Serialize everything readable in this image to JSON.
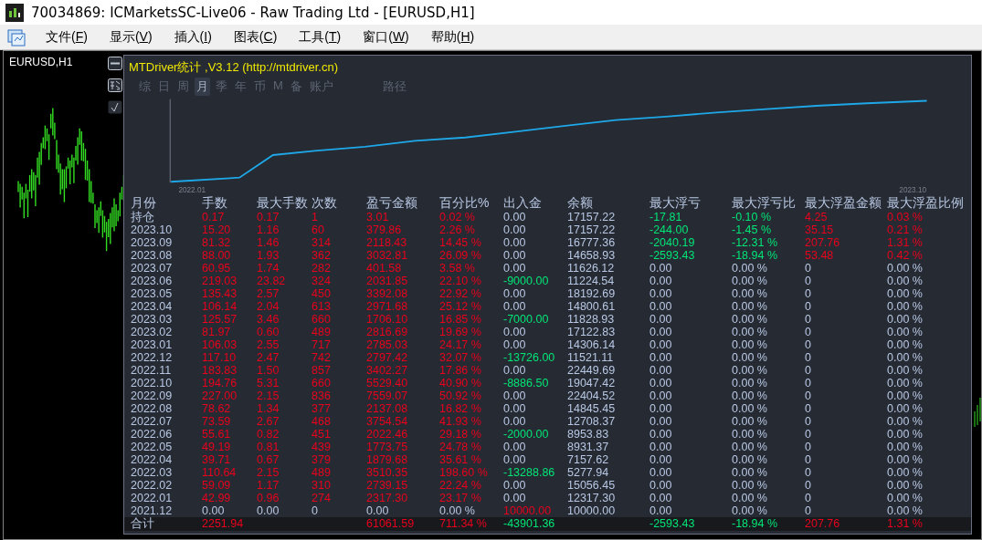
{
  "window": {
    "title": "70034869: ICMarketsSC-Live06 - Raw Trading Ltd - [EURUSD,H1]"
  },
  "menu": [
    {
      "label": "文件(F)"
    },
    {
      "label": "显示(V)"
    },
    {
      "label": "插入(I)"
    },
    {
      "label": "图表(C)"
    },
    {
      "label": "工具(T)"
    },
    {
      "label": "窗口(W)"
    },
    {
      "label": "帮助(H)"
    }
  ],
  "chart": {
    "symbol": "EURUSD,H1"
  },
  "panel": {
    "title": "MTDriver统计 ,V3.12 (http://mtdriver.cn)",
    "tabs": [
      {
        "label": "综",
        "selected": false
      },
      {
        "label": "日",
        "selected": false
      },
      {
        "label": "周",
        "selected": false
      },
      {
        "label": "月",
        "selected": true
      },
      {
        "label": "季",
        "selected": false
      },
      {
        "label": "年",
        "selected": false
      },
      {
        "label": "币",
        "selected": false
      },
      {
        "label": "M",
        "selected": false
      },
      {
        "label": "备",
        "selected": false
      },
      {
        "label": "账户",
        "selected": false
      },
      {
        "label": "路径",
        "selected": false
      }
    ],
    "equity_axis": {
      "start": "2022.01",
      "end": "2023.10"
    },
    "columns": [
      "月份",
      "手数",
      "最大手数",
      "次数",
      "盈亏金额",
      "百分比%",
      "出入金",
      "余额",
      "最大浮亏",
      "最大浮亏比",
      "最大浮盈金额",
      "最大浮盈比例"
    ],
    "rows": [
      {
        "cells": [
          {
            "text": "持仓",
            "color": "#b8c8e4"
          },
          {
            "text": "0.17",
            "color": "#e8001c"
          },
          {
            "text": "0.17",
            "color": "#e8001c"
          },
          {
            "text": "1",
            "color": "#e8001c"
          },
          {
            "text": "3.01",
            "color": "#e8001c"
          },
          {
            "text": "0.02 %",
            "color": "#e8001c"
          },
          {
            "text": "0.00",
            "color": "#b8c8e4"
          },
          {
            "text": "17157.22",
            "color": "#b8c8e4"
          },
          {
            "text": "-17.81",
            "color": "#00e676"
          },
          {
            "text": "-0.10 %",
            "color": "#00e676"
          },
          {
            "text": "4.25",
            "color": "#e8001c"
          },
          {
            "text": "0.03 %",
            "color": "#e8001c"
          }
        ]
      },
      {
        "cells": [
          {
            "text": "2023.10",
            "color": "#b8c8e4"
          },
          {
            "text": "15.20",
            "color": "#e8001c"
          },
          {
            "text": "1.16",
            "color": "#e8001c"
          },
          {
            "text": "60",
            "color": "#e8001c"
          },
          {
            "text": "379.86",
            "color": "#e8001c"
          },
          {
            "text": "2.26 %",
            "color": "#e8001c"
          },
          {
            "text": "0.00",
            "color": "#b8c8e4"
          },
          {
            "text": "17157.22",
            "color": "#b8c8e4"
          },
          {
            "text": "-244.00",
            "color": "#00e676"
          },
          {
            "text": "-1.45 %",
            "color": "#00e676"
          },
          {
            "text": "35.15",
            "color": "#e8001c"
          },
          {
            "text": "0.21 %",
            "color": "#e8001c"
          }
        ]
      },
      {
        "cells": [
          {
            "text": "2023.09",
            "color": "#b8c8e4"
          },
          {
            "text": "81.32",
            "color": "#e8001c"
          },
          {
            "text": "1.46",
            "color": "#e8001c"
          },
          {
            "text": "314",
            "color": "#e8001c"
          },
          {
            "text": "2118.43",
            "color": "#e8001c"
          },
          {
            "text": "14.45 %",
            "color": "#e8001c"
          },
          {
            "text": "0.00",
            "color": "#b8c8e4"
          },
          {
            "text": "16777.36",
            "color": "#b8c8e4"
          },
          {
            "text": "-2040.19",
            "color": "#00e676"
          },
          {
            "text": "-12.31 %",
            "color": "#00e676"
          },
          {
            "text": "207.76",
            "color": "#e8001c"
          },
          {
            "text": "1.31 %",
            "color": "#e8001c"
          }
        ]
      },
      {
        "cells": [
          {
            "text": "2023.08",
            "color": "#b8c8e4"
          },
          {
            "text": "88.00",
            "color": "#e8001c"
          },
          {
            "text": "1.93",
            "color": "#e8001c"
          },
          {
            "text": "362",
            "color": "#e8001c"
          },
          {
            "text": "3032.81",
            "color": "#e8001c"
          },
          {
            "text": "26.09 %",
            "color": "#e8001c"
          },
          {
            "text": "0.00",
            "color": "#b8c8e4"
          },
          {
            "text": "14658.93",
            "color": "#b8c8e4"
          },
          {
            "text": "-2593.43",
            "color": "#00e676"
          },
          {
            "text": "-18.94 %",
            "color": "#00e676"
          },
          {
            "text": "53.48",
            "color": "#e8001c"
          },
          {
            "text": "0.42 %",
            "color": "#e8001c"
          }
        ]
      },
      {
        "cells": [
          {
            "text": "2023.07",
            "color": "#b8c8e4"
          },
          {
            "text": "60.95",
            "color": "#e8001c"
          },
          {
            "text": "1.74",
            "color": "#e8001c"
          },
          {
            "text": "282",
            "color": "#e8001c"
          },
          {
            "text": "401.58",
            "color": "#e8001c"
          },
          {
            "text": "3.58 %",
            "color": "#e8001c"
          },
          {
            "text": "0.00",
            "color": "#b8c8e4"
          },
          {
            "text": "11626.12",
            "color": "#b8c8e4"
          },
          {
            "text": "0.00",
            "color": "#b8c8e4"
          },
          {
            "text": "0.00 %",
            "color": "#b8c8e4"
          },
          {
            "text": "0",
            "color": "#b8c8e4"
          },
          {
            "text": "0.00 %",
            "color": "#b8c8e4"
          }
        ]
      },
      {
        "cells": [
          {
            "text": "2023.06",
            "color": "#b8c8e4"
          },
          {
            "text": "219.03",
            "color": "#e8001c"
          },
          {
            "text": "23.82",
            "color": "#e8001c"
          },
          {
            "text": "324",
            "color": "#e8001c"
          },
          {
            "text": "2031.85",
            "color": "#e8001c"
          },
          {
            "text": "22.10 %",
            "color": "#e8001c"
          },
          {
            "text": "-9000.00",
            "color": "#00e676"
          },
          {
            "text": "11224.54",
            "color": "#b8c8e4"
          },
          {
            "text": "0.00",
            "color": "#b8c8e4"
          },
          {
            "text": "0.00 %",
            "color": "#b8c8e4"
          },
          {
            "text": "0",
            "color": "#b8c8e4"
          },
          {
            "text": "0.00 %",
            "color": "#b8c8e4"
          }
        ]
      },
      {
        "cells": [
          {
            "text": "2023.05",
            "color": "#b8c8e4"
          },
          {
            "text": "135.43",
            "color": "#e8001c"
          },
          {
            "text": "2.57",
            "color": "#e8001c"
          },
          {
            "text": "450",
            "color": "#e8001c"
          },
          {
            "text": "3392.08",
            "color": "#e8001c"
          },
          {
            "text": "22.92 %",
            "color": "#e8001c"
          },
          {
            "text": "0.00",
            "color": "#b8c8e4"
          },
          {
            "text": "18192.69",
            "color": "#b8c8e4"
          },
          {
            "text": "0.00",
            "color": "#b8c8e4"
          },
          {
            "text": "0.00 %",
            "color": "#b8c8e4"
          },
          {
            "text": "0",
            "color": "#b8c8e4"
          },
          {
            "text": "0.00 %",
            "color": "#b8c8e4"
          }
        ]
      },
      {
        "cells": [
          {
            "text": "2023.04",
            "color": "#b8c8e4"
          },
          {
            "text": "106.14",
            "color": "#e8001c"
          },
          {
            "text": "2.04",
            "color": "#e8001c"
          },
          {
            "text": "613",
            "color": "#e8001c"
          },
          {
            "text": "2971.68",
            "color": "#e8001c"
          },
          {
            "text": "25.12 %",
            "color": "#e8001c"
          },
          {
            "text": "0.00",
            "color": "#b8c8e4"
          },
          {
            "text": "14800.61",
            "color": "#b8c8e4"
          },
          {
            "text": "0.00",
            "color": "#b8c8e4"
          },
          {
            "text": "0.00 %",
            "color": "#b8c8e4"
          },
          {
            "text": "0",
            "color": "#b8c8e4"
          },
          {
            "text": "0.00 %",
            "color": "#b8c8e4"
          }
        ]
      },
      {
        "cells": [
          {
            "text": "2023.03",
            "color": "#b8c8e4"
          },
          {
            "text": "125.57",
            "color": "#e8001c"
          },
          {
            "text": "3.46",
            "color": "#e8001c"
          },
          {
            "text": "660",
            "color": "#e8001c"
          },
          {
            "text": "1706.10",
            "color": "#e8001c"
          },
          {
            "text": "16.85 %",
            "color": "#e8001c"
          },
          {
            "text": "-7000.00",
            "color": "#00e676"
          },
          {
            "text": "11828.93",
            "color": "#b8c8e4"
          },
          {
            "text": "0.00",
            "color": "#b8c8e4"
          },
          {
            "text": "0.00 %",
            "color": "#b8c8e4"
          },
          {
            "text": "0",
            "color": "#b8c8e4"
          },
          {
            "text": "0.00 %",
            "color": "#b8c8e4"
          }
        ]
      },
      {
        "cells": [
          {
            "text": "2023.02",
            "color": "#b8c8e4"
          },
          {
            "text": "81.97",
            "color": "#e8001c"
          },
          {
            "text": "0.60",
            "color": "#e8001c"
          },
          {
            "text": "489",
            "color": "#e8001c"
          },
          {
            "text": "2816.69",
            "color": "#e8001c"
          },
          {
            "text": "19.69 %",
            "color": "#e8001c"
          },
          {
            "text": "0.00",
            "color": "#b8c8e4"
          },
          {
            "text": "17122.83",
            "color": "#b8c8e4"
          },
          {
            "text": "0.00",
            "color": "#b8c8e4"
          },
          {
            "text": "0.00 %",
            "color": "#b8c8e4"
          },
          {
            "text": "0",
            "color": "#b8c8e4"
          },
          {
            "text": "0.00 %",
            "color": "#b8c8e4"
          }
        ]
      },
      {
        "cells": [
          {
            "text": "2023.01",
            "color": "#b8c8e4"
          },
          {
            "text": "106.03",
            "color": "#e8001c"
          },
          {
            "text": "2.55",
            "color": "#e8001c"
          },
          {
            "text": "717",
            "color": "#e8001c"
          },
          {
            "text": "2785.03",
            "color": "#e8001c"
          },
          {
            "text": "24.17 %",
            "color": "#e8001c"
          },
          {
            "text": "0.00",
            "color": "#b8c8e4"
          },
          {
            "text": "14306.14",
            "color": "#b8c8e4"
          },
          {
            "text": "0.00",
            "color": "#b8c8e4"
          },
          {
            "text": "0.00 %",
            "color": "#b8c8e4"
          },
          {
            "text": "0",
            "color": "#b8c8e4"
          },
          {
            "text": "0.00 %",
            "color": "#b8c8e4"
          }
        ]
      },
      {
        "cells": [
          {
            "text": "2022.12",
            "color": "#b8c8e4"
          },
          {
            "text": "117.10",
            "color": "#e8001c"
          },
          {
            "text": "2.47",
            "color": "#e8001c"
          },
          {
            "text": "742",
            "color": "#e8001c"
          },
          {
            "text": "2797.42",
            "color": "#e8001c"
          },
          {
            "text": "32.07 %",
            "color": "#e8001c"
          },
          {
            "text": "-13726.00",
            "color": "#00e676"
          },
          {
            "text": "11521.11",
            "color": "#b8c8e4"
          },
          {
            "text": "0.00",
            "color": "#b8c8e4"
          },
          {
            "text": "0.00 %",
            "color": "#b8c8e4"
          },
          {
            "text": "0",
            "color": "#b8c8e4"
          },
          {
            "text": "0.00 %",
            "color": "#b8c8e4"
          }
        ]
      },
      {
        "cells": [
          {
            "text": "2022.11",
            "color": "#b8c8e4"
          },
          {
            "text": "183.83",
            "color": "#e8001c"
          },
          {
            "text": "1.50",
            "color": "#e8001c"
          },
          {
            "text": "857",
            "color": "#e8001c"
          },
          {
            "text": "3402.27",
            "color": "#e8001c"
          },
          {
            "text": "17.86 %",
            "color": "#e8001c"
          },
          {
            "text": "0.00",
            "color": "#b8c8e4"
          },
          {
            "text": "22449.69",
            "color": "#b8c8e4"
          },
          {
            "text": "0.00",
            "color": "#b8c8e4"
          },
          {
            "text": "0.00 %",
            "color": "#b8c8e4"
          },
          {
            "text": "0",
            "color": "#b8c8e4"
          },
          {
            "text": "0.00 %",
            "color": "#b8c8e4"
          }
        ]
      },
      {
        "cells": [
          {
            "text": "2022.10",
            "color": "#b8c8e4"
          },
          {
            "text": "194.76",
            "color": "#e8001c"
          },
          {
            "text": "5.31",
            "color": "#e8001c"
          },
          {
            "text": "660",
            "color": "#e8001c"
          },
          {
            "text": "5529.40",
            "color": "#e8001c"
          },
          {
            "text": "40.90 %",
            "color": "#e8001c"
          },
          {
            "text": "-8886.50",
            "color": "#00e676"
          },
          {
            "text": "19047.42",
            "color": "#b8c8e4"
          },
          {
            "text": "0.00",
            "color": "#b8c8e4"
          },
          {
            "text": "0.00 %",
            "color": "#b8c8e4"
          },
          {
            "text": "0",
            "color": "#b8c8e4"
          },
          {
            "text": "0.00 %",
            "color": "#b8c8e4"
          }
        ]
      },
      {
        "cells": [
          {
            "text": "2022.09",
            "color": "#b8c8e4"
          },
          {
            "text": "227.00",
            "color": "#e8001c"
          },
          {
            "text": "2.15",
            "color": "#e8001c"
          },
          {
            "text": "836",
            "color": "#e8001c"
          },
          {
            "text": "7559.07",
            "color": "#e8001c"
          },
          {
            "text": "50.92 %",
            "color": "#e8001c"
          },
          {
            "text": "0.00",
            "color": "#b8c8e4"
          },
          {
            "text": "22404.52",
            "color": "#b8c8e4"
          },
          {
            "text": "0.00",
            "color": "#b8c8e4"
          },
          {
            "text": "0.00 %",
            "color": "#b8c8e4"
          },
          {
            "text": "0",
            "color": "#b8c8e4"
          },
          {
            "text": "0.00 %",
            "color": "#b8c8e4"
          }
        ]
      },
      {
        "cells": [
          {
            "text": "2022.08",
            "color": "#b8c8e4"
          },
          {
            "text": "78.62",
            "color": "#e8001c"
          },
          {
            "text": "1.34",
            "color": "#e8001c"
          },
          {
            "text": "377",
            "color": "#e8001c"
          },
          {
            "text": "2137.08",
            "color": "#e8001c"
          },
          {
            "text": "16.82 %",
            "color": "#e8001c"
          },
          {
            "text": "0.00",
            "color": "#b8c8e4"
          },
          {
            "text": "14845.45",
            "color": "#b8c8e4"
          },
          {
            "text": "0.00",
            "color": "#b8c8e4"
          },
          {
            "text": "0.00 %",
            "color": "#b8c8e4"
          },
          {
            "text": "0",
            "color": "#b8c8e4"
          },
          {
            "text": "0.00 %",
            "color": "#b8c8e4"
          }
        ]
      },
      {
        "cells": [
          {
            "text": "2022.07",
            "color": "#b8c8e4"
          },
          {
            "text": "73.59",
            "color": "#e8001c"
          },
          {
            "text": "2.67",
            "color": "#e8001c"
          },
          {
            "text": "468",
            "color": "#e8001c"
          },
          {
            "text": "3754.54",
            "color": "#e8001c"
          },
          {
            "text": "41.93 %",
            "color": "#e8001c"
          },
          {
            "text": "0.00",
            "color": "#b8c8e4"
          },
          {
            "text": "12708.37",
            "color": "#b8c8e4"
          },
          {
            "text": "0.00",
            "color": "#b8c8e4"
          },
          {
            "text": "0.00 %",
            "color": "#b8c8e4"
          },
          {
            "text": "0",
            "color": "#b8c8e4"
          },
          {
            "text": "0.00 %",
            "color": "#b8c8e4"
          }
        ]
      },
      {
        "cells": [
          {
            "text": "2022.06",
            "color": "#b8c8e4"
          },
          {
            "text": "55.61",
            "color": "#e8001c"
          },
          {
            "text": "0.82",
            "color": "#e8001c"
          },
          {
            "text": "451",
            "color": "#e8001c"
          },
          {
            "text": "2022.46",
            "color": "#e8001c"
          },
          {
            "text": "29.18 %",
            "color": "#e8001c"
          },
          {
            "text": "-2000.00",
            "color": "#00e676"
          },
          {
            "text": "8953.83",
            "color": "#b8c8e4"
          },
          {
            "text": "0.00",
            "color": "#b8c8e4"
          },
          {
            "text": "0.00 %",
            "color": "#b8c8e4"
          },
          {
            "text": "0",
            "color": "#b8c8e4"
          },
          {
            "text": "0.00 %",
            "color": "#b8c8e4"
          }
        ]
      },
      {
        "cells": [
          {
            "text": "2022.05",
            "color": "#b8c8e4"
          },
          {
            "text": "49.19",
            "color": "#e8001c"
          },
          {
            "text": "0.81",
            "color": "#e8001c"
          },
          {
            "text": "439",
            "color": "#e8001c"
          },
          {
            "text": "1773.75",
            "color": "#e8001c"
          },
          {
            "text": "24.78 %",
            "color": "#e8001c"
          },
          {
            "text": "0.00",
            "color": "#b8c8e4"
          },
          {
            "text": "8931.37",
            "color": "#b8c8e4"
          },
          {
            "text": "0.00",
            "color": "#b8c8e4"
          },
          {
            "text": "0.00 %",
            "color": "#b8c8e4"
          },
          {
            "text": "0",
            "color": "#b8c8e4"
          },
          {
            "text": "0.00 %",
            "color": "#b8c8e4"
          }
        ]
      },
      {
        "cells": [
          {
            "text": "2022.04",
            "color": "#b8c8e4"
          },
          {
            "text": "39.71",
            "color": "#e8001c"
          },
          {
            "text": "0.67",
            "color": "#e8001c"
          },
          {
            "text": "379",
            "color": "#e8001c"
          },
          {
            "text": "1879.68",
            "color": "#e8001c"
          },
          {
            "text": "35.61 %",
            "color": "#e8001c"
          },
          {
            "text": "0.00",
            "color": "#b8c8e4"
          },
          {
            "text": "7157.62",
            "color": "#b8c8e4"
          },
          {
            "text": "0.00",
            "color": "#b8c8e4"
          },
          {
            "text": "0.00 %",
            "color": "#b8c8e4"
          },
          {
            "text": "0",
            "color": "#b8c8e4"
          },
          {
            "text": "0.00 %",
            "color": "#b8c8e4"
          }
        ]
      },
      {
        "cells": [
          {
            "text": "2022.03",
            "color": "#b8c8e4"
          },
          {
            "text": "110.64",
            "color": "#e8001c"
          },
          {
            "text": "2.15",
            "color": "#e8001c"
          },
          {
            "text": "489",
            "color": "#e8001c"
          },
          {
            "text": "3510.35",
            "color": "#e8001c"
          },
          {
            "text": "198.60 %",
            "color": "#e8001c"
          },
          {
            "text": "-13288.86",
            "color": "#00e676"
          },
          {
            "text": "5277.94",
            "color": "#b8c8e4"
          },
          {
            "text": "0.00",
            "color": "#b8c8e4"
          },
          {
            "text": "0.00 %",
            "color": "#b8c8e4"
          },
          {
            "text": "0",
            "color": "#b8c8e4"
          },
          {
            "text": "0.00 %",
            "color": "#b8c8e4"
          }
        ]
      },
      {
        "cells": [
          {
            "text": "2022.02",
            "color": "#b8c8e4"
          },
          {
            "text": "59.09",
            "color": "#e8001c"
          },
          {
            "text": "1.17",
            "color": "#e8001c"
          },
          {
            "text": "310",
            "color": "#e8001c"
          },
          {
            "text": "2739.15",
            "color": "#e8001c"
          },
          {
            "text": "22.24 %",
            "color": "#e8001c"
          },
          {
            "text": "0.00",
            "color": "#b8c8e4"
          },
          {
            "text": "15056.45",
            "color": "#b8c8e4"
          },
          {
            "text": "0.00",
            "color": "#b8c8e4"
          },
          {
            "text": "0.00 %",
            "color": "#b8c8e4"
          },
          {
            "text": "0",
            "color": "#b8c8e4"
          },
          {
            "text": "0.00 %",
            "color": "#b8c8e4"
          }
        ]
      },
      {
        "cells": [
          {
            "text": "2022.01",
            "color": "#b8c8e4"
          },
          {
            "text": "42.99",
            "color": "#e8001c"
          },
          {
            "text": "0.96",
            "color": "#e8001c"
          },
          {
            "text": "274",
            "color": "#e8001c"
          },
          {
            "text": "2317.30",
            "color": "#e8001c"
          },
          {
            "text": "23.17 %",
            "color": "#e8001c"
          },
          {
            "text": "0.00",
            "color": "#b8c8e4"
          },
          {
            "text": "12317.30",
            "color": "#b8c8e4"
          },
          {
            "text": "0.00",
            "color": "#b8c8e4"
          },
          {
            "text": "0.00 %",
            "color": "#b8c8e4"
          },
          {
            "text": "0",
            "color": "#b8c8e4"
          },
          {
            "text": "0.00 %",
            "color": "#b8c8e4"
          }
        ]
      },
      {
        "cells": [
          {
            "text": "2021.12",
            "color": "#b8c8e4"
          },
          {
            "text": "0.00",
            "color": "#b8c8e4"
          },
          {
            "text": "0.00",
            "color": "#b8c8e4"
          },
          {
            "text": "0",
            "color": "#b8c8e4"
          },
          {
            "text": "0.00",
            "color": "#b8c8e4"
          },
          {
            "text": "0.00 %",
            "color": "#b8c8e4"
          },
          {
            "text": "10000.00",
            "color": "#e8001c"
          },
          {
            "text": "10000.00",
            "color": "#b8c8e4"
          },
          {
            "text": "0.00",
            "color": "#b8c8e4"
          },
          {
            "text": "0.00 %",
            "color": "#b8c8e4"
          },
          {
            "text": "0",
            "color": "#b8c8e4"
          },
          {
            "text": "0.00 %",
            "color": "#b8c8e4"
          }
        ]
      }
    ],
    "total": [
      {
        "kind": "value",
        "text": "合计",
        "color": "#b8c8e4"
      },
      {
        "kind": "value",
        "text": "2251.94",
        "color": "#e8001c"
      },
      {
        "kind": "blank"
      },
      {
        "kind": "blank"
      },
      {
        "kind": "value",
        "text": "61061.59",
        "color": "#e8001c"
      },
      {
        "kind": "value",
        "text": "711.34 %",
        "color": "#e8001c"
      },
      {
        "kind": "value",
        "text": "-43901.36",
        "color": "#00e676"
      },
      {
        "kind": "blank"
      },
      {
        "kind": "value",
        "text": "-2593.43",
        "color": "#00e676"
      },
      {
        "kind": "value",
        "text": "-18.94 %",
        "color": "#00e676"
      },
      {
        "kind": "value",
        "text": "207.76",
        "color": "#e8001c"
      },
      {
        "kind": "value",
        "text": "1.31 %",
        "color": "#e8001c"
      }
    ]
  }
}
